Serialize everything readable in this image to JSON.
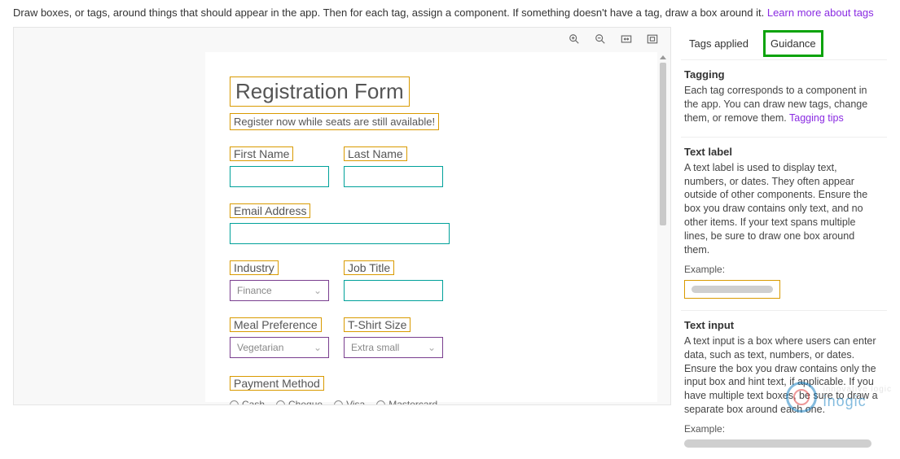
{
  "instruction": {
    "text": "Draw boxes, or tags, around things that should appear in the app. Then for each tag, assign a component. If something doesn't have a tag, draw a box around it.",
    "link": "Learn more about tags"
  },
  "form": {
    "title": "Registration Form",
    "subtitle": "Register now while seats are still available!",
    "firstName": "First Name",
    "lastName": "Last Name",
    "email": "Email Address",
    "industry": "Industry",
    "industryValue": "Finance",
    "jobTitle": "Job Title",
    "meal": "Meal Preference",
    "mealValue": "Vegetarian",
    "tshirt": "T-Shirt Size",
    "tshirtValue": "Extra small",
    "payment": "Payment Method",
    "payOptions": [
      "Cash",
      "Cheque",
      "Visa",
      "Mastercard"
    ]
  },
  "sidebar": {
    "tabs": {
      "applied": "Tags applied",
      "guidance": "Guidance"
    },
    "tagging": {
      "title": "Tagging",
      "body": "Each tag corresponds to a component in the app. You can draw new tags, change them, or remove them.",
      "link": "Tagging tips"
    },
    "textLabel": {
      "title": "Text label",
      "body": "A text label is used to display text, numbers, or dates. They often appear outside of other components. Ensure the box you draw contains only text, and no other items. If your text spans multiple lines, be sure to draw one box around them.",
      "example": "Example:"
    },
    "textInput": {
      "title": "Text input",
      "body": "A text input is a box where users can enter data, such as text, numbers, or dates. Ensure the box you draw contains only the input box and hint text, if applicable. If you have multiple text boxes, be sure to draw a separate box around each one.",
      "example": "Example:"
    }
  },
  "watermark": {
    "l1": "innovative logic",
    "l2": "inogic"
  }
}
